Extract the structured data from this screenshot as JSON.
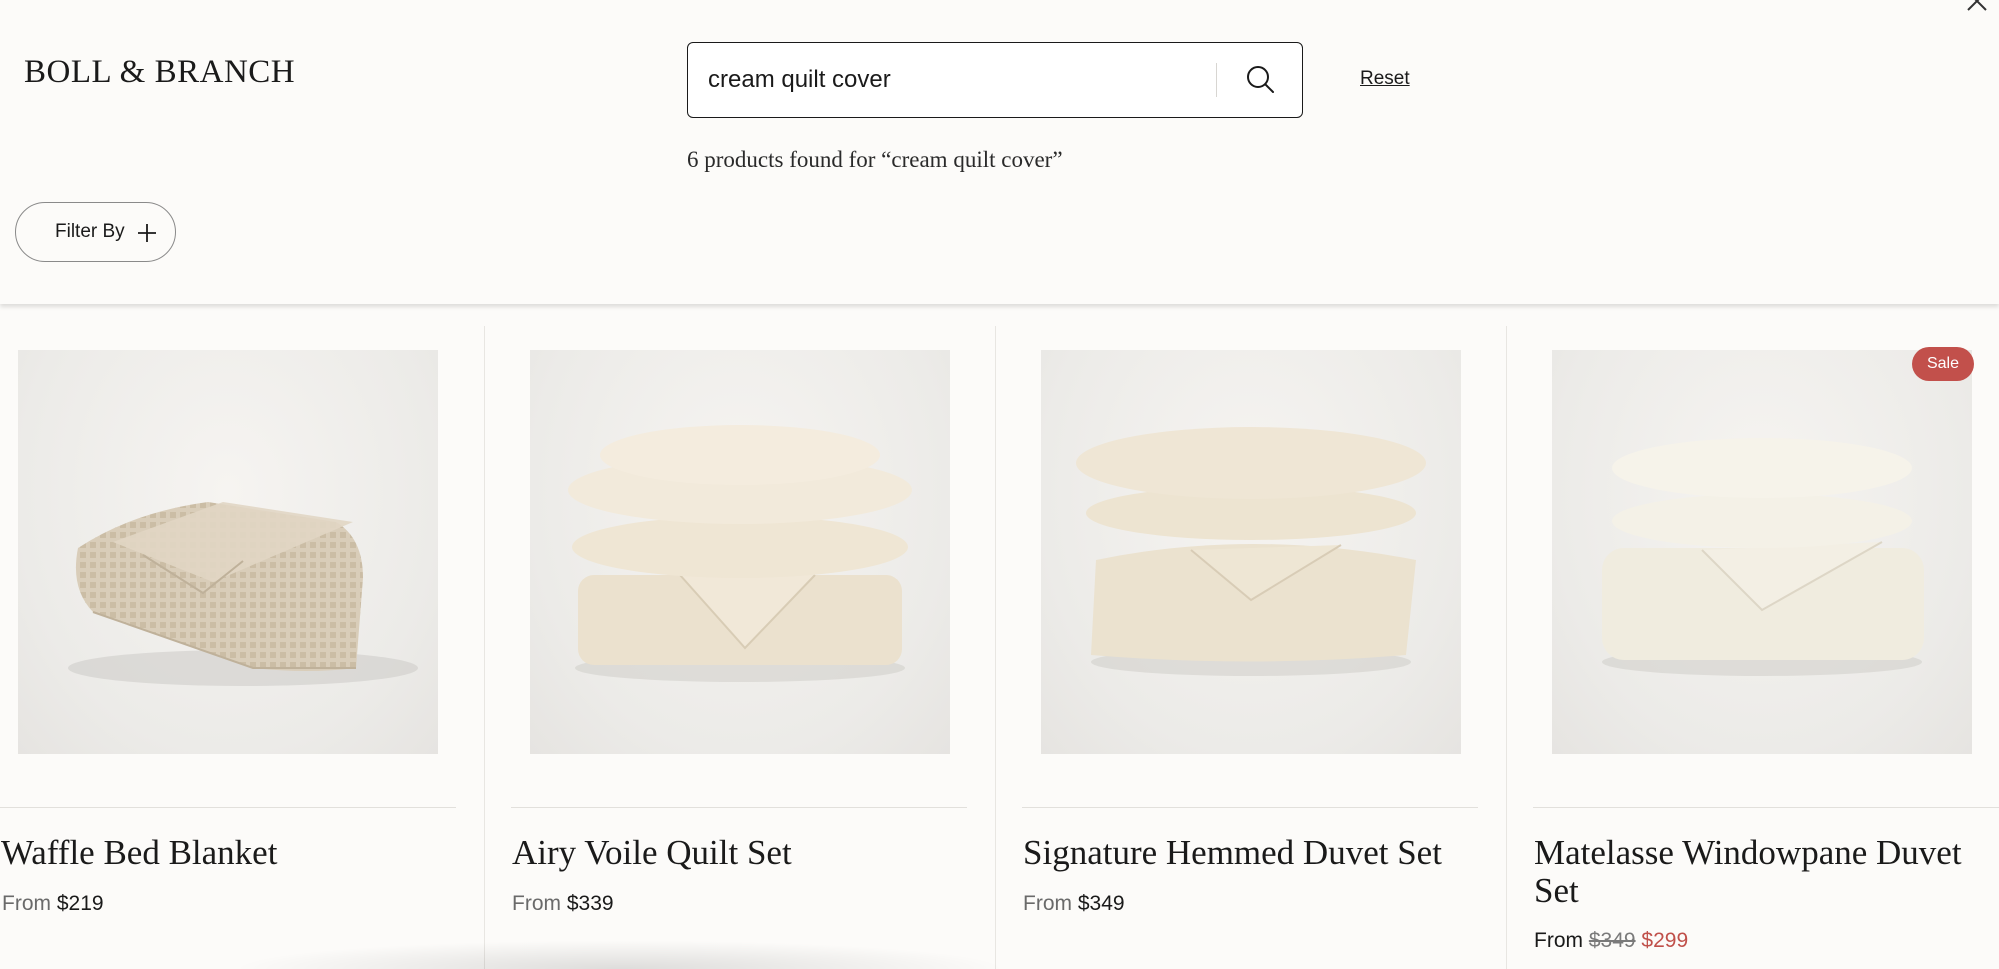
{
  "brand": {
    "logo_text": "BOLL & BRANCH"
  },
  "search": {
    "query": "cream quilt cover",
    "reset_label": "Reset",
    "results_text": "6 products found for “cream quilt cover”"
  },
  "filter": {
    "label": "Filter By"
  },
  "icons": {
    "close": "close-icon",
    "search": "search-icon",
    "plus": "plus-icon"
  },
  "colors": {
    "background": "#fcfbf9",
    "sale_badge": "#c2504b",
    "sale_price": "#c0504a"
  },
  "products": [
    {
      "title": "Waffle Bed Blanket",
      "price_prefix": "From",
      "price": "$219"
    },
    {
      "title": "Airy Voile Quilt Set",
      "price_prefix": "From",
      "price": "$339"
    },
    {
      "title": "Signature Hemmed Duvet Set",
      "price_prefix": "From",
      "price": "$349"
    },
    {
      "title": "Matelasse Windowpane Duvet Set",
      "price_prefix": "From",
      "original_price": "$349",
      "sale_price": "$299",
      "badge": "Sale"
    }
  ]
}
